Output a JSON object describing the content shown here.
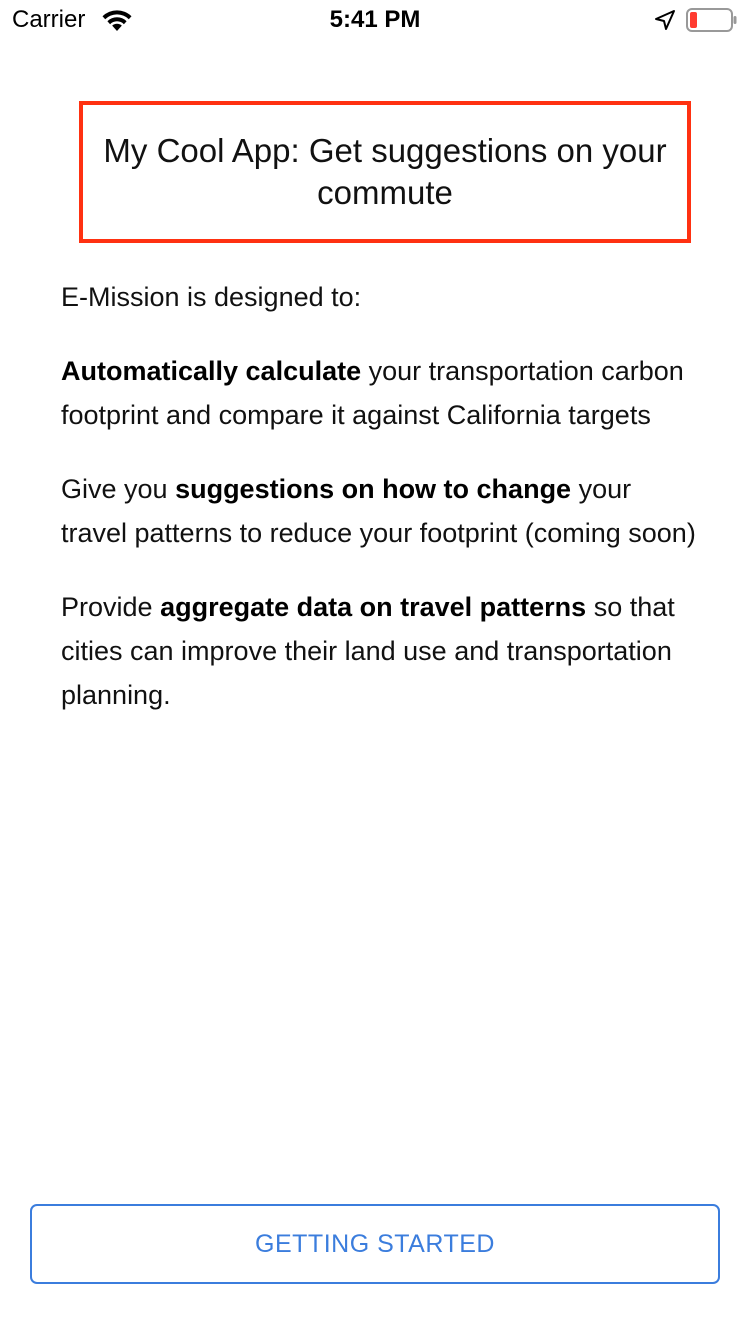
{
  "status_bar": {
    "carrier": "Carrier",
    "time": "5:41 PM",
    "icons": [
      "wifi-icon",
      "location-arrow-icon",
      "battery-low-icon"
    ],
    "battery_color": "#ff3b30"
  },
  "header": {
    "title": "My Cool App: Get suggestions on your commute",
    "border_color": "#ff3111"
  },
  "intro": {
    "text": "E-Mission is designed to:",
    "items": [
      {
        "bold": "Automatically calculate",
        "after": " your transportation carbon footprint and compare it against California targets"
      },
      {
        "before": "Give you ",
        "bold": "suggestions on how to change",
        "after": " your travel patterns to reduce your footprint (coming soon)"
      },
      {
        "before": "Provide ",
        "bold": "aggregate data on travel patterns",
        "after": " so that cities can improve their land use and transportation planning."
      }
    ]
  },
  "actions": {
    "getting_started_label": "GETTING STARTED",
    "accent_color": "#3b7ddd"
  }
}
